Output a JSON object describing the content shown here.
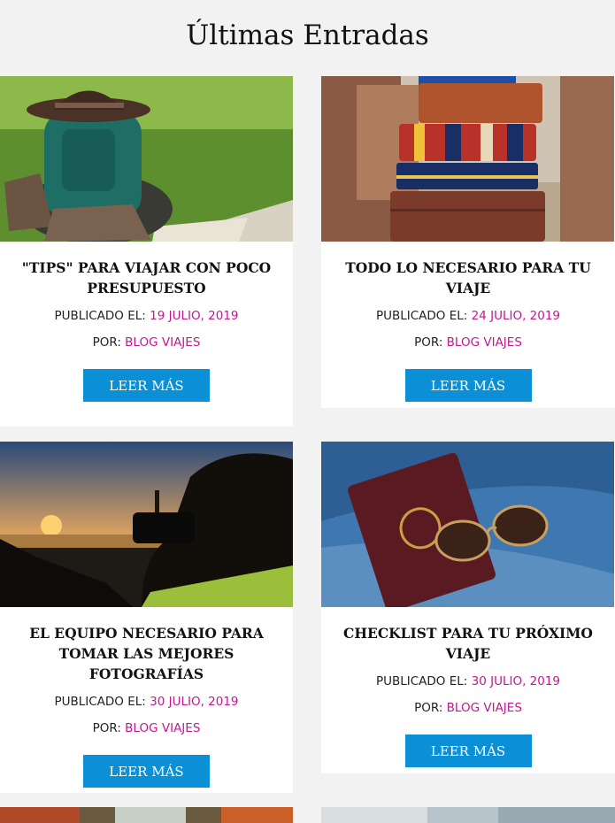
{
  "heading": "Últimas Entradas",
  "labels": {
    "published": "PUBLICADO EL:",
    "by": "POR:",
    "read_more": "LEER MÁS"
  },
  "posts": [
    {
      "title": "\"TIPS\" PARA VIAJAR CON POCO PRESUPUESTO",
      "date": "19 JULIO, 2019",
      "author": "BLOG VIAJES",
      "image": "backpack-hat-boots-map"
    },
    {
      "title": "TODO LO NECESARIO PARA TU VIAJE",
      "date": "24 JULIO, 2019",
      "author": "BLOG VIAJES",
      "image": "stacked-suitcases"
    },
    {
      "title": "EL EQUIPO NECESARIO PARA TOMAR LAS MEJORES FOTOGRAFÍAS",
      "date": "30 JULIO, 2019",
      "author": "BLOG VIAJES",
      "image": "photographer-sunset"
    },
    {
      "title": "CHECKLIST PARA TU PRÓXIMO VIAJE",
      "date": "30 JULIO, 2019",
      "author": "BLOG VIAJES",
      "image": "passport-sunglasses-denim"
    }
  ],
  "colors": {
    "accent": "#c2188f",
    "button": "#0b8fd6",
    "background": "#f2f2f2"
  }
}
